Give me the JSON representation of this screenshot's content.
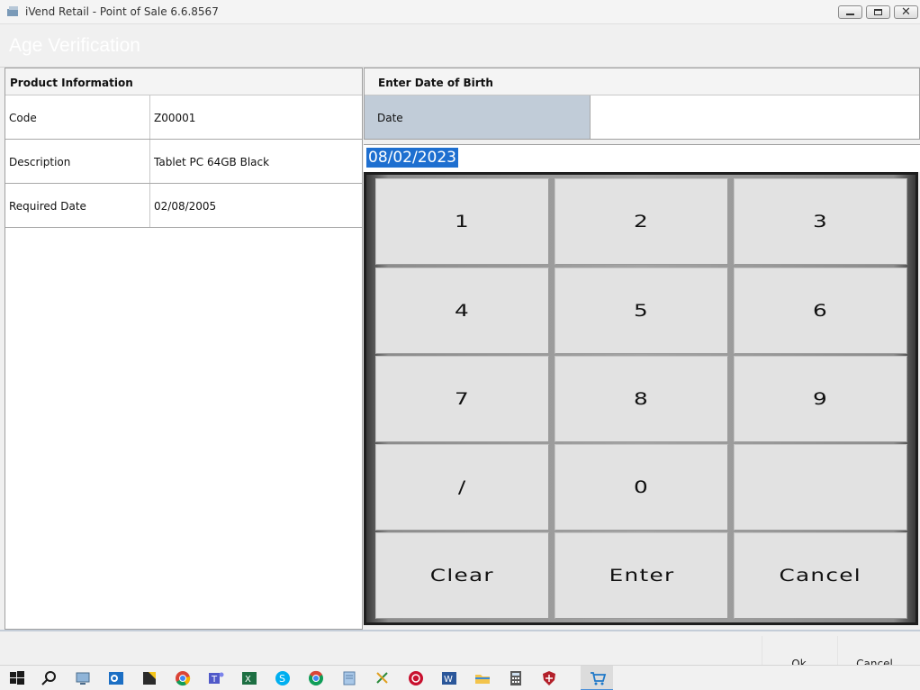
{
  "window": {
    "title": "iVend Retail - Point of Sale 6.6.8567",
    "close_glyph": "✕"
  },
  "dialog": {
    "title": "Age Verification"
  },
  "product_info": {
    "header": "Product Information",
    "rows": [
      {
        "label": "Code",
        "value": "Z00001"
      },
      {
        "label": "Description",
        "value": "Tablet PC 64GB Black"
      },
      {
        "label": "Required Date",
        "value": "02/08/2005"
      }
    ]
  },
  "dob": {
    "header": "Enter Date of Birth",
    "date_label": "Date",
    "input_value": "08/02/2023"
  },
  "keypad": {
    "keys": [
      "1",
      "2",
      "3",
      "4",
      "5",
      "6",
      "7",
      "8",
      "9",
      "/",
      "0",
      "",
      "Clear",
      "Enter",
      "Cancel"
    ]
  },
  "footer": {
    "ok_label": "Ok",
    "cancel_label": "Cancel"
  },
  "taskbar": {
    "icons": [
      "windows-start-icon",
      "search-icon",
      "computer-icon",
      "outlook-icon",
      "sticky-notes-icon",
      "chrome-icon",
      "teams-icon",
      "excel-icon",
      "skype-icon",
      "chrome-alt-icon",
      "notepad-icon",
      "snipping-tool-icon",
      "app-red-icon",
      "word-icon",
      "file-explorer-icon",
      "calculator-icon",
      "shield-app-icon",
      "ivend-cart-icon"
    ]
  },
  "colors": {
    "date_label_bg": "#c1ccd8",
    "selection": "#1e6fd0",
    "keypad_frame": "#1e1e1e"
  }
}
